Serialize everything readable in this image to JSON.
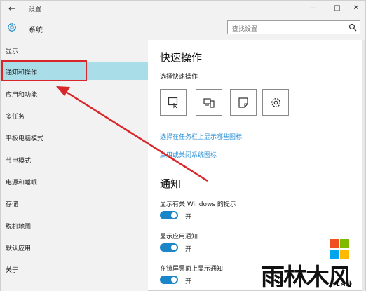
{
  "window": {
    "title": "设置",
    "back": "←",
    "minimize": "—",
    "maximize": "□",
    "close": "✕"
  },
  "header": {
    "title": "系统",
    "search_placeholder": "查找设置"
  },
  "sidebar": {
    "items": [
      {
        "label": "显示"
      },
      {
        "label": "通知和操作"
      },
      {
        "label": "应用和功能"
      },
      {
        "label": "多任务"
      },
      {
        "label": "平板电脑模式"
      },
      {
        "label": "节电模式"
      },
      {
        "label": "电源和睡眠"
      },
      {
        "label": "存储"
      },
      {
        "label": "脱机地图"
      },
      {
        "label": "默认应用"
      },
      {
        "label": "关于"
      }
    ],
    "selected": "通知和操作"
  },
  "main": {
    "quick_actions_title": "快速操作",
    "quick_actions_sub": "选择快速操作",
    "quick_action_icons": [
      "tablet-mode-icon",
      "connect-icon",
      "note-icon",
      "settings-icon"
    ],
    "link_taskbar": "选择在任务栏上显示哪些图标",
    "link_system_icons": "启用或关闭系统图标",
    "notifications_title": "通知",
    "settings": [
      {
        "label": "显示有关 Windows 的提示",
        "state": "开",
        "on": true
      },
      {
        "label": "显示应用通知",
        "state": "开",
        "on": true
      },
      {
        "label": "在锁屏界面上显示通知",
        "state": "开",
        "on": true
      }
    ]
  },
  "colors": {
    "accent": "#1a86c8",
    "link": "#2b8fd6",
    "selected_bg": "#a9dde8",
    "annotation": "#d8262b"
  },
  "watermark": {
    "brand": "雨林木风",
    "sub": "YLMF"
  }
}
